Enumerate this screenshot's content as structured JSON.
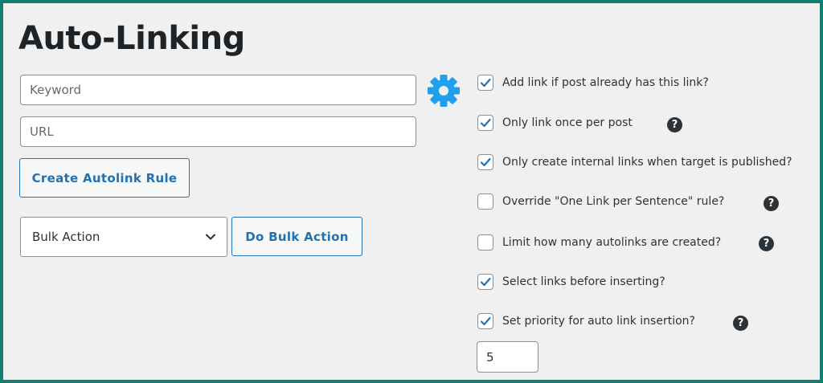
{
  "page": {
    "title": "Auto-Linking"
  },
  "form": {
    "keyword_placeholder": "Keyword",
    "url_placeholder": "URL",
    "create_button": "Create Autolink Rule",
    "bulk_select_value": "Bulk Action",
    "bulk_button": "Do Bulk Action"
  },
  "options": [
    {
      "label": "Add link if post already has this link?",
      "checked": true,
      "help": false
    },
    {
      "label": "Only link once per post",
      "checked": true,
      "help": true
    },
    {
      "label": "Only create internal links when target is published?",
      "checked": true,
      "help": false
    },
    {
      "label": "Override \"One Link per Sentence\" rule?",
      "checked": false,
      "help": true
    },
    {
      "label": "Limit how many autolinks are created?",
      "checked": false,
      "help": true
    },
    {
      "label": "Select links before inserting?",
      "checked": true,
      "help": false
    },
    {
      "label": "Set priority for auto link insertion?",
      "checked": true,
      "help": true
    }
  ],
  "priority": {
    "value": "5"
  },
  "help_glyph": "?",
  "icons": {
    "settings": "gear-icon",
    "check": "checkmark-icon",
    "help": "help-icon",
    "dropdown": "chevron-down-icon"
  },
  "colors": {
    "frame_border": "#127e72",
    "background": "#f0f0f1",
    "accent_blue": "#2271b1",
    "gear_blue": "#1ea0ee"
  }
}
